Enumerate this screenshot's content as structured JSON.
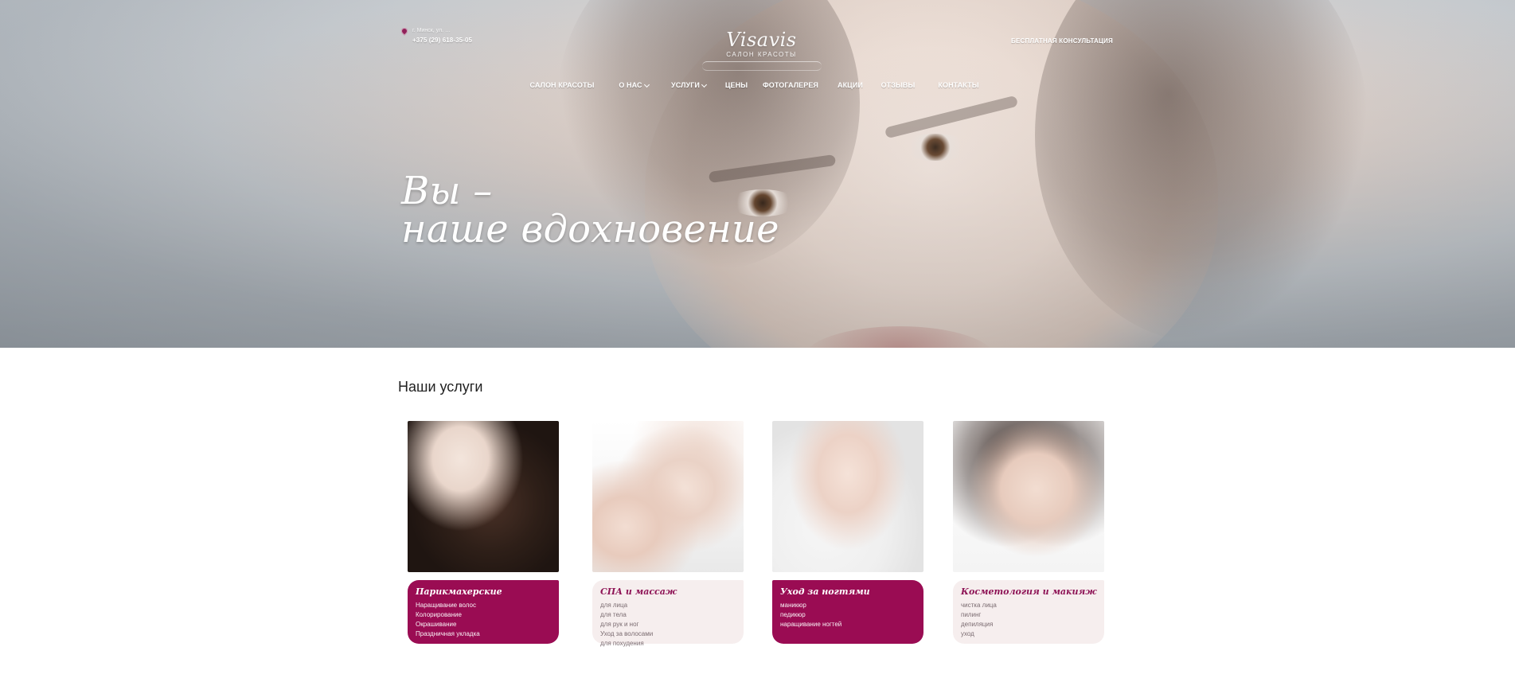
{
  "header": {
    "phone_label": "+375 (29) 618-35-05",
    "phone_small": "г. Минск, ул. …",
    "logo": {
      "brand": "Visavis",
      "subtitle": "САЛОН КРАСОТЫ"
    },
    "cta": "БЕСПЛАТНАЯ КОНСУЛЬТАЦИЯ"
  },
  "nav": {
    "items": [
      {
        "label": "САЛОН КРАСОТЫ",
        "has_dropdown": false
      },
      {
        "label": "О НАС",
        "has_dropdown": true
      },
      {
        "label": "УСЛУГИ",
        "has_dropdown": true
      },
      {
        "label": "ЦЕНЫ",
        "has_dropdown": false
      },
      {
        "label": "ФОТОГАЛЕРЕЯ",
        "has_dropdown": false
      },
      {
        "label": "АКЦИИ",
        "has_dropdown": false
      },
      {
        "label": "ОТЗЫВЫ",
        "has_dropdown": false
      },
      {
        "label": "КОНТАКТЫ",
        "has_dropdown": false
      }
    ]
  },
  "hero": {
    "title_line1": "Вы –",
    "title_line2": "наше вдохновение"
  },
  "services": {
    "title": "Наши услуги",
    "cards": [
      {
        "title": "Парикмахерские",
        "items": [
          "Наращивание волос",
          "Колорирование",
          "Окрашивание",
          "Праздничная укладка"
        ],
        "active": true
      },
      {
        "title": "СПА и массаж",
        "items": [
          "для лица",
          "для тела",
          "для рук и ног",
          "Уход за волосами",
          "для похудения"
        ],
        "active": false
      },
      {
        "title": "Уход за ногтями",
        "items": [
          "маникюр",
          "педикюр",
          "наращивание ногтей"
        ],
        "active": true
      },
      {
        "title": "Косметология и макияж",
        "items": [
          "чистка лица",
          "пилинг",
          "депиляция",
          "уход"
        ],
        "active": false
      }
    ]
  },
  "colors": {
    "accent": "#9a0c53",
    "accent_text": "#8e1456",
    "card_bg": "#f6eeee"
  },
  "icons": {
    "location": "location-pin-icon",
    "dropdown": "chevron-down-icon"
  }
}
